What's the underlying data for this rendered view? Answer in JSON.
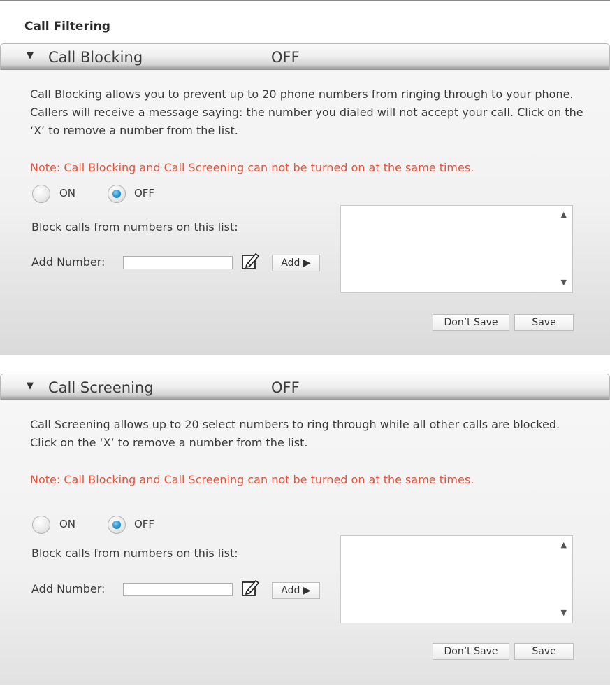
{
  "page": {
    "title": "Call Filtering"
  },
  "sections": [
    {
      "title": "Call Blocking",
      "status": "OFF",
      "description": "Call Blocking allows you to prevent up to 20 phone numbers from ringing through to your phone. Callers will receive a message saying: the number you dialed will not accept your call. Click on the ‘X’ to remove a number from the list.",
      "note": "Note: Call Blocking and Call Screening can not be turned on at the same times.",
      "radio_on_label": "ON",
      "radio_off_label": "OFF",
      "selected": "OFF",
      "list_label": "Block calls from numbers on this list:",
      "add_number_label": "Add Number:",
      "add_number_value": "",
      "add_button": "Add ▶",
      "dont_save_button": "Don’t Save",
      "save_button": "Save"
    },
    {
      "title": "Call Screening",
      "status": "OFF",
      "description": "Call Screening allows up to 20 select numbers to ring through while all other calls are blocked. Click on the ‘X’ to remove a number from the list.",
      "note": "Note: Call Blocking and Call Screening can not be turned on at the same times.",
      "radio_on_label": "ON",
      "radio_off_label": "OFF",
      "selected": "OFF",
      "list_label": "Block calls from numbers on this list:",
      "add_number_label": "Add Number:",
      "add_number_value": "",
      "add_button": "Add ▶",
      "dont_save_button": "Don’t Save",
      "save_button": "Save"
    }
  ],
  "icons": {
    "collapse": "triangle-down-icon",
    "edit": "pencil-icon",
    "scroll_up": "triangle-up-icon",
    "scroll_down": "triangle-down-icon"
  },
  "colors": {
    "note": "#e8533b",
    "radio_selected": "#2a8fd0",
    "text": "#3a3a3a"
  }
}
